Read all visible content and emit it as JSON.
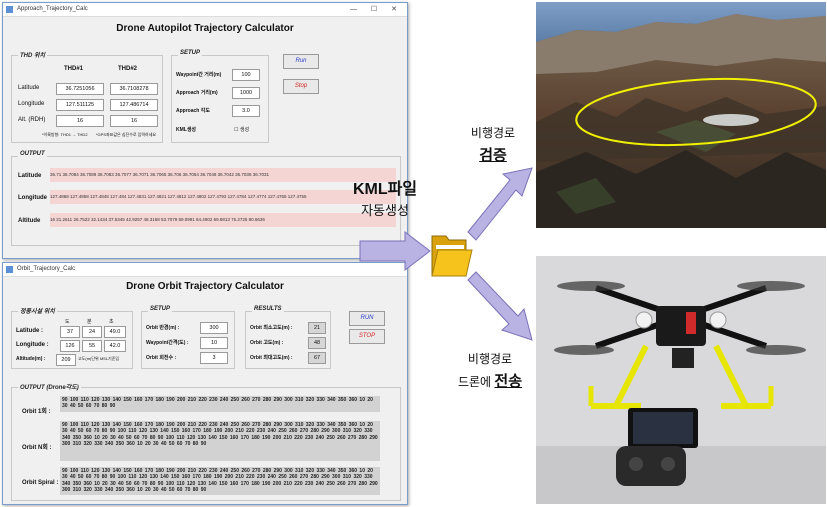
{
  "approach_window": {
    "window_title": "Approach_Trajectory_Calc",
    "app_title": "Drone Autopilot Trajectory Calculator",
    "thd_group": "THD 위치",
    "col1": "THD#1",
    "col2": "THD#2",
    "lat_label": "Latitude",
    "lon_label": "Longitude",
    "alt_label": "Alt. (RDH)",
    "lat1": "36.7251056",
    "lat2": "36.7108278",
    "lon1": "127.511125",
    "lon2": "127.486714",
    "alt1": "16",
    "alt2": "16",
    "note1": "*이륙방향: THD1 → THD2",
    "note2": "*GPS좌표값은 십진수로 입력하세요",
    "setup_group": "SETUP",
    "wp_label": "Waypoint간 거리(m)",
    "wp_value": "100",
    "appd_label": "Approach 거리(m)",
    "appd_value": "1000",
    "appa_label": "Approach 각도",
    "appa_value": "3.0",
    "kml_label": "KML생성",
    "kml_check": "☐ 생성",
    "run_label": "Run",
    "stop_label": "Stop",
    "output_group": "OUTPUT",
    "out_lat_label": "Latitude",
    "out_lon_label": "Longitude",
    "out_alt_label": "Altitude",
    "out_lat_values": "36.71   36.7084   36.7089   36.7083   36.7077   36.7071   36.7065   36.706   36.7054   36.7048   36.7042   36.7036   36.7031",
    "out_lon_values": "127.4868   127.4858   127.4848   127.484   127.4831   127.4821   127.4812   127.4802   127.4793   127.4784   127.4774   127.4765   127.4755",
    "out_alt_values": "16   21.2611   26.7522   32.1434   37.5345   42.9257   48.3168   53.7079   59.0991   64.4902   69.8813   75.2725   80.6636"
  },
  "orbit_window": {
    "window_title": "Orbit_Trajectory_Calc",
    "app_title": "Drone Orbit Trajectory Calculator",
    "pos_group": "정풍시설 위치",
    "deg": "도",
    "min": "분",
    "sec": "초",
    "lat_label": "Latitude :",
    "lon_label": "Longitude :",
    "alt_label": "Altitude(m) :",
    "lat_d": "37",
    "lat_m": "24",
    "lat_s": "49.0",
    "lon_d": "126",
    "lon_m": "55",
    "lon_s": "42.0",
    "alt_val": "209",
    "alt_note": "고도(m)단위 MSL기준임",
    "setup_group": "SETUP",
    "radius_label": "Orbit 반경(m) :",
    "radius_val": "300",
    "wpint_label": "Waypoint간격(도) :",
    "wpint_val": "10",
    "circles_label": "Orbit 회전수 :",
    "circles_val": "3",
    "results_group": "RESULTS",
    "r1_label": "Orbit 최소고도(m) :",
    "r1_val": "21",
    "r2_label": "Orbit 고도(m) :",
    "r2_val": "48",
    "r3_label": "Orbit 최대고도(m) :",
    "r3_val": "67",
    "run_label": "RUN",
    "stop_label": "STOP",
    "output_group": "OUTPUT (Drone각도)",
    "o1_label": "Orbit 1회 :",
    "o2_label": "Orbit N회 :",
    "o3_label": "Orbit Spiral :",
    "o1_values": "90 100 110 120 130 140 150 160 170 180 190 200 210 220 230 240 250 260 270 280 290 300 310 320 330 340 350 360 10 20 30 40 50 60 70 80 90",
    "o2_values": "90 100 110 120 130 140 150 160 170 180 190 200 210 220 230 240 250 260 270 280 290 300 310 320 330 340 350 360 10 20 30 40 50 60 70 80 90 100 110 120 130 140 150 160 170 180 190 200 210 220 230 240 250 260 270 280 290 300 310 320 330 340 350 360 10 20 30 40 50 60 70 80 90 100 110 120 130 140 150 160 170 180 190 200 210 220 230 240 250 260 270 280 290 300 310 320 330 340 350 360 10 20 30 40 50 60 70 80 90",
    "o3_values": "90 100 110 120 130 140 150 160 170 180 190 200 210 220 230 240 250 260 270 280 290 300 310 320 330 340 350 360 10 20 30 40 50 60 70 80 90 100 110 120 130 140 150 160 170 180 190 200 210 220 230 240 250 260 270 280 290 300 310 320 330 340 350 360 10 20 30 40 50 60 70 80 90 100 110 120 130 140 150 160 170 180 190 200 210 220 230 240 250 260 270 280 290 300 310 320 330 340 350 360 10 20 30 40 50 60 70 80 90"
  },
  "labels": {
    "kml_line1": "KML파일",
    "kml_line2": "자동생성",
    "verify_line1": "비행경로",
    "verify_line2": "검증",
    "send_line1": "비행경로",
    "send_line2a": "드론에 ",
    "send_line2b": "전송"
  },
  "colors": {
    "arrow": "#b9b3e3",
    "arrow_stroke": "#7a70b8",
    "folder": "#f6c21c",
    "terrain": "#5b4230",
    "sky": "#5c7ea8",
    "orbit_ellipse": "#f0f000",
    "output_band": "#f5d4d4"
  }
}
